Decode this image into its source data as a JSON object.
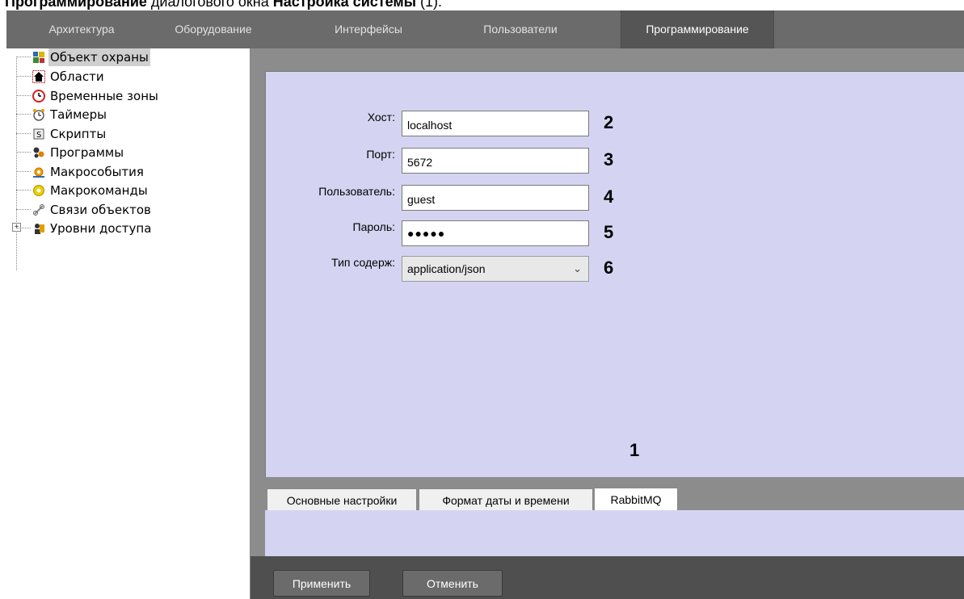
{
  "caption": {
    "part1": "Программирование",
    "part2": " диалогового окна ",
    "part3": "Настройка системы",
    "part4": " (1)."
  },
  "top_tabs": [
    {
      "label": "Архитектура"
    },
    {
      "label": "Оборудование"
    },
    {
      "label": "Интерфейсы"
    },
    {
      "label": "Пользователи"
    },
    {
      "label": "Программирование",
      "active": true
    }
  ],
  "tree": {
    "items": [
      {
        "label": "Объект охраны",
        "icon": "guard-object-icon",
        "selected": true
      },
      {
        "label": "Области",
        "icon": "area-house-icon"
      },
      {
        "label": "Временные зоны",
        "icon": "clock-icon"
      },
      {
        "label": "Таймеры",
        "icon": "alarm-clock-icon"
      },
      {
        "label": "Скрипты",
        "icon": "script-icon"
      },
      {
        "label": "Программы",
        "icon": "programs-icon"
      },
      {
        "label": "Макрособытия",
        "icon": "macro-event-icon"
      },
      {
        "label": "Макрокоманды",
        "icon": "macro-command-icon",
        "expandable": true
      },
      {
        "label": "Связи объектов",
        "icon": "link-icon"
      },
      {
        "label": "Уровни доступа",
        "icon": "access-level-icon"
      }
    ]
  },
  "form": {
    "host_label": "Хост:",
    "host_value": "localhost",
    "port_label": "Порт:",
    "port_value": "5672",
    "user_label": "Пользователь:",
    "user_value": "guest",
    "password_label": "Пароль:",
    "password_value": "●●●●●",
    "content_type_label": "Тип содерж:",
    "content_type_value": "application/json"
  },
  "callouts": {
    "n1": "1",
    "n2": "2",
    "n3": "3",
    "n4": "4",
    "n5": "5",
    "n6": "6"
  },
  "sub_tabs": [
    {
      "label": "Основные настройки"
    },
    {
      "label": "Формат даты и времени"
    },
    {
      "label": "RabbitMQ",
      "active": true
    }
  ],
  "buttons": {
    "apply": "Применить",
    "cancel": "Отменить"
  },
  "colors": {
    "panel_bg": "#d4d4f2",
    "tabbar_bg": "#6b6b6b",
    "active_tab_bg": "#555555"
  }
}
